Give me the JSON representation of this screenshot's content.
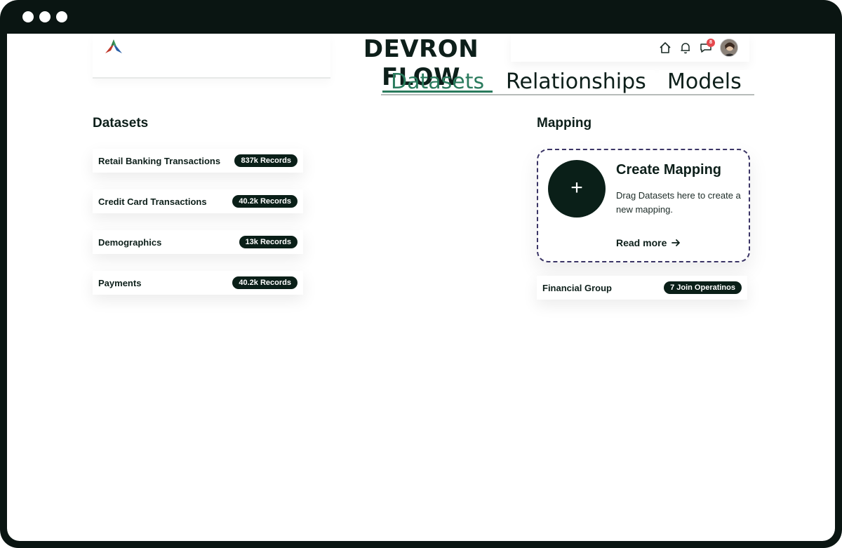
{
  "header": {
    "brand": "DEVRON FLOW",
    "notification_count": "8",
    "icons": [
      "home-icon",
      "bell-icon",
      "chat-icon",
      "avatar"
    ]
  },
  "tabs": [
    {
      "label": "Datasets",
      "active": true
    },
    {
      "label": "Relationships",
      "active": false
    },
    {
      "label": "Models",
      "active": false
    }
  ],
  "datasets": {
    "title": "Datasets",
    "items": [
      {
        "name": "Retail Banking Transactions",
        "count": "837k Records"
      },
      {
        "name": "Credit Card Transactions",
        "count": "40.2k Records"
      },
      {
        "name": "Demographics",
        "count": "13k Records"
      },
      {
        "name": "Payments",
        "count": "40.2k Records"
      }
    ]
  },
  "mapping": {
    "title": "Mapping",
    "card": {
      "plus": "+",
      "title": "Create Mapping",
      "description": "Drag Datasets here to create a new mapping.",
      "read_more": "Read more"
    },
    "group": {
      "name": "Financial Group",
      "count": "7 Join Operatinos"
    }
  },
  "colors": {
    "accent": "#2a7b5d",
    "dark": "#0a1f18",
    "badge": "#e5484d",
    "dashed_border": "#3b3566"
  }
}
